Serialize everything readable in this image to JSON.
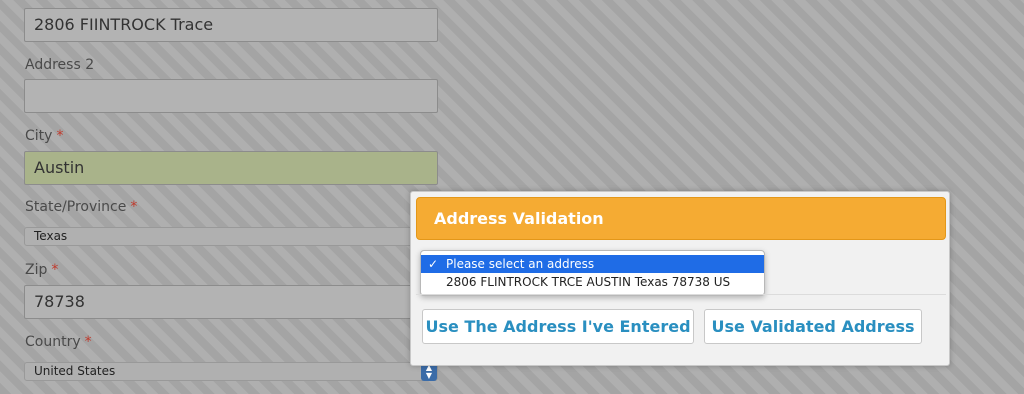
{
  "form": {
    "address1": {
      "value": "2806 FIINTROCK Trace"
    },
    "address2": {
      "label": "Address 2",
      "value": ""
    },
    "city": {
      "label": "City",
      "required_mark": "*",
      "value": "Austin"
    },
    "state": {
      "label": "State/Province",
      "required_mark": "*",
      "value": "Texas"
    },
    "zip": {
      "label": "Zip",
      "required_mark": "*",
      "value": "78738"
    },
    "country": {
      "label": "Country",
      "required_mark": "*",
      "value": "United States"
    }
  },
  "dialog": {
    "title": "Address Validation",
    "options": [
      {
        "label": "Please select an address",
        "selected": true,
        "check": "✓"
      },
      {
        "label": "2806 FLINTROCK TRCE AUSTIN Texas 78738 US",
        "selected": false
      }
    ],
    "use_entered_label": "Use The Address I've Entered",
    "use_validated_label": "Use Validated Address"
  },
  "colors": {
    "header": "#f5ab33",
    "button_text": "#2a8fc0",
    "highlight": "#1f6ce6"
  }
}
